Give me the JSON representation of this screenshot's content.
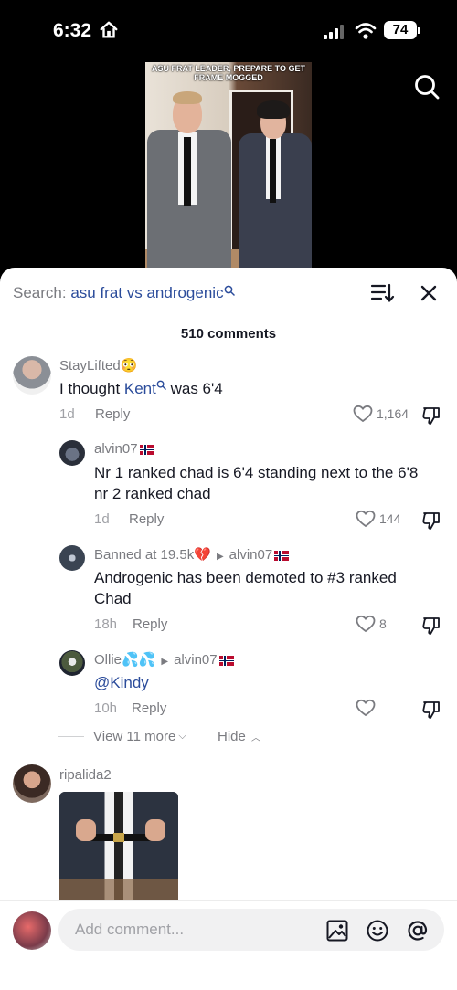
{
  "status": {
    "time": "6:32",
    "battery": "74"
  },
  "video": {
    "caption": "ASU FRAT LEADER, PREPARE TO GET FRAME MOGGED"
  },
  "sheet": {
    "search_prefix": "Search: ",
    "search_query": "asu frat vs androgenic",
    "comment_count": "510 comments"
  },
  "comments": [
    {
      "user": "StayLifted😳",
      "text_before": "I thought ",
      "mention": "Kent",
      "text_after": " was 6'4",
      "time": "1d",
      "reply": "Reply",
      "likes": "1,164"
    },
    {
      "user": "alvin07",
      "text": "Nr 1 ranked chad is 6'4 standing next to the 6'8 nr 2 ranked chad",
      "time": "1d",
      "reply": "Reply",
      "likes": "144"
    },
    {
      "user": "Banned at 19.5k💔",
      "reply_to": "alvin07",
      "text": "Androgenic has been demoted to #3 ranked Chad",
      "time": "18h",
      "reply": "Reply",
      "likes": "8"
    },
    {
      "user": "Ollie💦💦",
      "reply_to": "alvin07",
      "text": "@Kindy",
      "time": "10h",
      "reply": "Reply",
      "likes": ""
    },
    {
      "user": "ripalida2"
    }
  ],
  "thread": {
    "view_more": "View 11 more",
    "hide": "Hide"
  },
  "input": {
    "placeholder": "Add comment..."
  },
  "colors": {
    "accent_link": "#2b4c9b",
    "muted": "#7a7b80",
    "text": "#161823"
  }
}
